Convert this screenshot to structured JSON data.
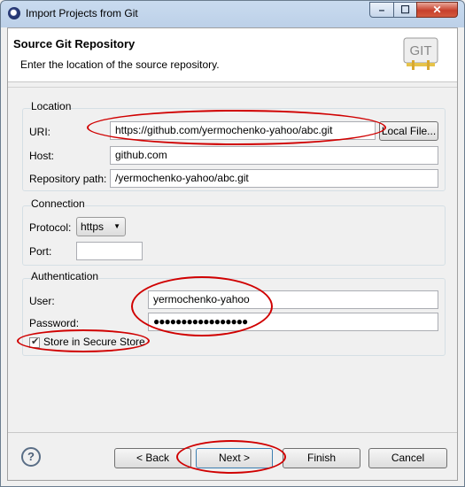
{
  "window": {
    "title": "Import Projects from Git"
  },
  "header": {
    "title": "Source Git Repository",
    "description": "Enter the location of the source repository.",
    "logo_text": "GIT"
  },
  "location": {
    "group_label": "Location",
    "uri_label": "URI:",
    "uri_value": "https://github.com/yermochenko-yahoo/abc.git",
    "local_file_button": "Local File...",
    "host_label": "Host:",
    "host_value": "github.com",
    "repo_path_label": "Repository path:",
    "repo_path_value": "/yermochenko-yahoo/abc.git"
  },
  "connection": {
    "group_label": "Connection",
    "protocol_label": "Protocol:",
    "protocol_value": "https",
    "port_label": "Port:",
    "port_value": ""
  },
  "authentication": {
    "group_label": "Authentication",
    "user_label": "User:",
    "user_value": "yermochenko-yahoo",
    "password_label": "Password:",
    "password_value": "●●●●●●●●●●●●●●●●●",
    "store_label": "Store in Secure Store",
    "store_checked": true
  },
  "buttons": {
    "back": "< Back",
    "next": "Next >",
    "finish": "Finish",
    "cancel": "Cancel"
  },
  "colors": {
    "annotation": "#d00000"
  }
}
